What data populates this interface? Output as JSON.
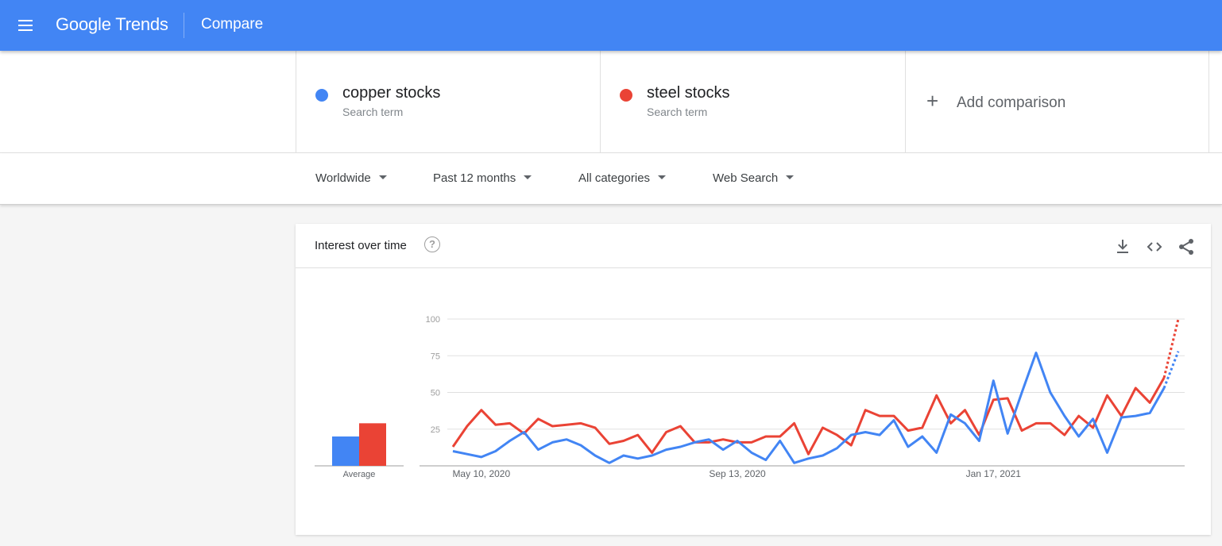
{
  "header": {
    "logo_google": "Google",
    "logo_trends": "Trends",
    "page_name": "Compare"
  },
  "terms": [
    {
      "name": "copper stocks",
      "subtitle": "Search term",
      "color": "#4285f4"
    },
    {
      "name": "steel stocks",
      "subtitle": "Search term",
      "color": "#ea4335"
    }
  ],
  "add_comparison": {
    "plus": "+",
    "label": "Add comparison"
  },
  "filters": {
    "region": "Worldwide",
    "time": "Past 12 months",
    "category": "All categories",
    "search_type": "Web Search"
  },
  "card": {
    "title": "Interest over time",
    "help": "?"
  },
  "icons": {
    "menu": "menu-icon",
    "help": "help-icon",
    "download": "download-icon",
    "embed": "code-icon",
    "share": "share-icon"
  },
  "chart_data": {
    "type": "line",
    "title": "Interest over time",
    "ylim": [
      0,
      100
    ],
    "y_ticks": [
      25,
      50,
      75,
      100
    ],
    "x_tick_labels": [
      "May 10, 2020",
      "Sep 13, 2020",
      "Jan 17, 2021"
    ],
    "x_tick_index": [
      2,
      20,
      38
    ],
    "average_label": "Average",
    "dotted_last_segment": true,
    "series": [
      {
        "name": "copper stocks",
        "color": "#4285f4",
        "average": 20,
        "values": [
          10,
          8,
          6,
          10,
          17,
          23,
          11,
          16,
          18,
          14,
          7,
          2,
          7,
          5,
          7,
          11,
          13,
          16,
          18,
          11,
          17,
          9,
          4,
          17,
          2,
          5,
          7,
          12,
          21,
          23,
          21,
          31,
          13,
          20,
          9,
          35,
          29,
          17,
          58,
          22,
          50,
          77,
          50,
          34,
          20,
          32,
          9,
          33,
          34,
          36,
          53,
          78
        ]
      },
      {
        "name": "steel stocks",
        "color": "#ea4335",
        "average": 29,
        "values": [
          13,
          27,
          38,
          28,
          29,
          22,
          32,
          27,
          28,
          29,
          26,
          15,
          17,
          21,
          9,
          23,
          27,
          16,
          16,
          18,
          16,
          16,
          20,
          20,
          29,
          8,
          26,
          21,
          14,
          38,
          34,
          34,
          24,
          26,
          48,
          29,
          38,
          21,
          45,
          46,
          24,
          29,
          29,
          21,
          34,
          26,
          48,
          34,
          53,
          43,
          60,
          100
        ]
      }
    ]
  }
}
